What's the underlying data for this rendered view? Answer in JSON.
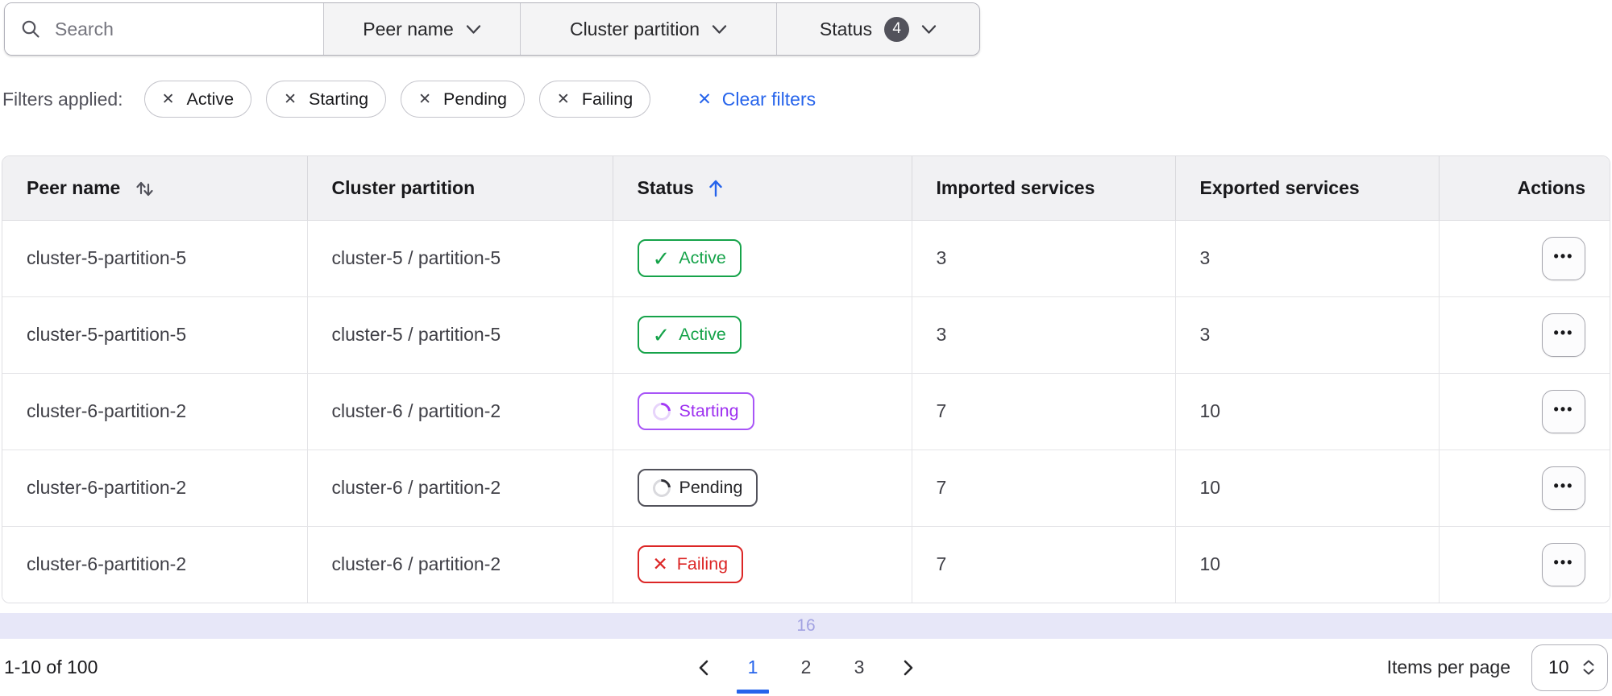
{
  "colors": {
    "accent_blue": "#2563eb",
    "active_green": "#16a34a",
    "starting_purple": "#a855f7",
    "pending_gray": "#52525b",
    "failing_red": "#dc2626",
    "badge_count_bg": "#52525b",
    "strip_lavender": "#e7e7f8"
  },
  "icons": {
    "check": "✓",
    "close": "✕",
    "ellipsis": "•••"
  },
  "toolbar": {
    "search": {
      "placeholder": "Search"
    },
    "dropdowns": [
      {
        "label": "Peer name",
        "badge": ""
      },
      {
        "label": "Cluster partition",
        "badge": ""
      },
      {
        "label": "Status",
        "badge": "4"
      }
    ]
  },
  "applied_filters": {
    "label": "Filters applied:",
    "chips": [
      "Active",
      "Starting",
      "Pending",
      "Failing"
    ],
    "clear_label": "Clear filters"
  },
  "table": {
    "columns": {
      "peer_name": "Peer name",
      "cluster_partition": "Cluster partition",
      "status": "Status",
      "imported": "Imported services",
      "exported": "Exported services",
      "actions": "Actions"
    },
    "sort": {
      "peer_name": "unsorted",
      "status": "ascending"
    },
    "rows": [
      {
        "peer_name": "cluster-5-partition-5",
        "cluster_partition": "cluster-5 / partition-5",
        "status": "Active",
        "imported": "3",
        "exported": "3"
      },
      {
        "peer_name": "cluster-5-partition-5",
        "cluster_partition": "cluster-5 / partition-5",
        "status": "Active",
        "imported": "3",
        "exported": "3"
      },
      {
        "peer_name": "cluster-6-partition-2",
        "cluster_partition": "cluster-6 / partition-2",
        "status": "Starting",
        "imported": "7",
        "exported": "10"
      },
      {
        "peer_name": "cluster-6-partition-2",
        "cluster_partition": "cluster-6 / partition-2",
        "status": "Pending",
        "imported": "7",
        "exported": "10"
      },
      {
        "peer_name": "cluster-6-partition-2",
        "cluster_partition": "cluster-6 / partition-2",
        "status": "Failing",
        "imported": "7",
        "exported": "10"
      }
    ],
    "status_styles": {
      "Active": {
        "icon": "check",
        "border": "#16a34a",
        "text": "#16a34a"
      },
      "Starting": {
        "icon": "spinner",
        "border": "#a855f7",
        "text": "#9d2ff0",
        "track": "#e7d4fb",
        "arc": "#a33bf5"
      },
      "Pending": {
        "icon": "spinner",
        "border": "#52525b",
        "text": "#27272a",
        "track": "#d9d9dd",
        "arc": "#2f2f36"
      },
      "Failing": {
        "icon": "x",
        "border": "#dc2626",
        "text": "#dc2626"
      }
    }
  },
  "count_indicator": "16",
  "pagination": {
    "range_label": "1-10 of 100",
    "pages": [
      "1",
      "2",
      "3"
    ],
    "active_page": "1",
    "items_per_page_label": "Items per page",
    "items_per_page_value": "10"
  }
}
